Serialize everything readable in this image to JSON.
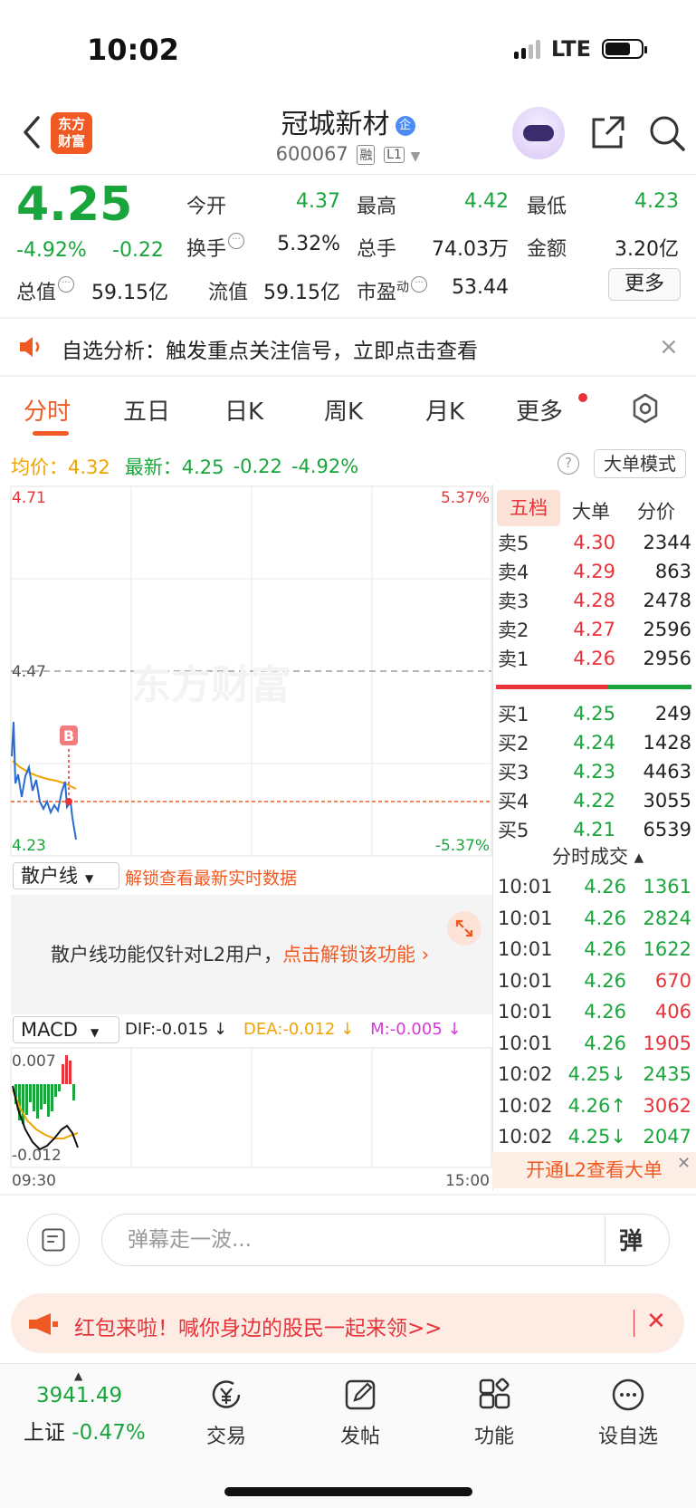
{
  "status": {
    "time": "10:02",
    "network": "LTE"
  },
  "header": {
    "logo_line1": "东方",
    "logo_line2": "财富",
    "stock_name": "冠城新材",
    "badge": "企",
    "stock_code": "600067",
    "tag_margin": "融",
    "tag_level": "L1"
  },
  "quote": {
    "price": "4.25",
    "change_pct": "-4.92%",
    "change": "-0.22",
    "open_label": "今开",
    "open": "4.37",
    "high_label": "最高",
    "high": "4.42",
    "low_label": "最低",
    "low": "4.23",
    "turnover_label": "换手",
    "turnover": "5.32%",
    "volume_label": "总手",
    "volume": "74.03万",
    "amount_label": "金额",
    "amount": "3.20亿",
    "mktcap_label": "总值",
    "mktcap": "59.15亿",
    "float_label": "流值",
    "float": "59.15亿",
    "pe_label": "市盈",
    "pe_sup": "动",
    "pe": "53.44",
    "more_label": "更多"
  },
  "notice": {
    "text": "自选分析：触发重点关注信号，立即点击查看",
    "close": "×"
  },
  "tabs": {
    "intraday": "分时",
    "five_day": "五日",
    "daily_k": "日K",
    "weekly_k": "周K",
    "monthly_k": "月K",
    "more": "更多"
  },
  "avg_row": {
    "avg_label": "均价：",
    "avg_value": "4.32",
    "latest_label": "最新：",
    "latest_value": "4.25",
    "latest_change": "-0.22",
    "latest_pct": "-4.92%",
    "help": "?",
    "big_order_mode": "大单模式"
  },
  "chart": {
    "y_top_left": "4.71",
    "y_top_right": "5.37%",
    "y_mid": "4.47",
    "y_bottom_left": "4.23",
    "y_bottom_right": "-5.37%",
    "marker": "B",
    "watermark": "东方财富",
    "macd_top": "0.007",
    "macd_bottom": "-0.012",
    "time_start": "09:30",
    "time_end": "15:00",
    "colors": {
      "up": "#e8333a",
      "down": "#1aa53c",
      "price_line": "#2a6bd1",
      "avg_line": "#f0a400"
    }
  },
  "retail": {
    "select": "散户线",
    "unlock": "解锁查看最新实时数据",
    "message": "散户线功能仅针对L2用户，",
    "link": "点击解锁该功能 ›"
  },
  "macd": {
    "select": "MACD",
    "dif": "DIF:-0.015 ↓",
    "dea": "DEA:-0.012 ↓",
    "m": "M:-0.005 ↓"
  },
  "orderbook": {
    "tab_five": "五档",
    "tab_big": "大单",
    "tab_price": "分价",
    "asks": [
      {
        "label": "卖5",
        "price": "4.30",
        "vol": "2344",
        "dir": "up"
      },
      {
        "label": "卖4",
        "price": "4.29",
        "vol": "863",
        "dir": "up"
      },
      {
        "label": "卖3",
        "price": "4.28",
        "vol": "2478",
        "dir": "up"
      },
      {
        "label": "卖2",
        "price": "4.27",
        "vol": "2596",
        "dir": "up"
      },
      {
        "label": "卖1",
        "price": "4.26",
        "vol": "2956",
        "dir": "up"
      }
    ],
    "bids": [
      {
        "label": "买1",
        "price": "4.25",
        "vol": "249",
        "dir": "down"
      },
      {
        "label": "买2",
        "price": "4.24",
        "vol": "1428",
        "dir": "down"
      },
      {
        "label": "买3",
        "price": "4.23",
        "vol": "4463",
        "dir": "down"
      },
      {
        "label": "买4",
        "price": "4.22",
        "vol": "3055",
        "dir": "down"
      },
      {
        "label": "买5",
        "price": "4.21",
        "vol": "6539",
        "dir": "down"
      }
    ],
    "ticks_header": "分时成交 ▴",
    "ticks": [
      {
        "time": "10:01",
        "price": "4.26",
        "vol": "1361",
        "pdir": "down",
        "vdir": "down"
      },
      {
        "time": "10:01",
        "price": "4.26",
        "vol": "2824",
        "pdir": "down",
        "vdir": "down"
      },
      {
        "time": "10:01",
        "price": "4.26",
        "vol": "1622",
        "pdir": "down",
        "vdir": "down"
      },
      {
        "time": "10:01",
        "price": "4.26",
        "vol": "670",
        "pdir": "down",
        "vdir": "up"
      },
      {
        "time": "10:01",
        "price": "4.26",
        "vol": "406",
        "pdir": "down",
        "vdir": "up"
      },
      {
        "time": "10:01",
        "price": "4.26",
        "vol": "1905",
        "pdir": "down",
        "vdir": "up"
      },
      {
        "time": "10:02",
        "price": "4.25↓",
        "vol": "2435",
        "pdir": "down",
        "vdir": "down"
      },
      {
        "time": "10:02",
        "price": "4.26↑",
        "vol": "3062",
        "pdir": "down",
        "vdir": "up"
      },
      {
        "time": "10:02",
        "price": "4.25↓",
        "vol": "2047",
        "pdir": "down",
        "vdir": "down"
      }
    ],
    "l2_banner": "开通L2查看大单",
    "l2_close": "✕"
  },
  "comment": {
    "placeholder": "弹幕走一波...",
    "button": "弹"
  },
  "redpacket": {
    "text": "红包来啦！喊你身边的股民一起来领>>",
    "close": "✕"
  },
  "bottom_nav": {
    "index_value": "3941.49",
    "index_name": "上证",
    "index_pct": "-0.47%",
    "trade": "交易",
    "post": "发帖",
    "features": "功能",
    "add_watch": "设自选"
  }
}
